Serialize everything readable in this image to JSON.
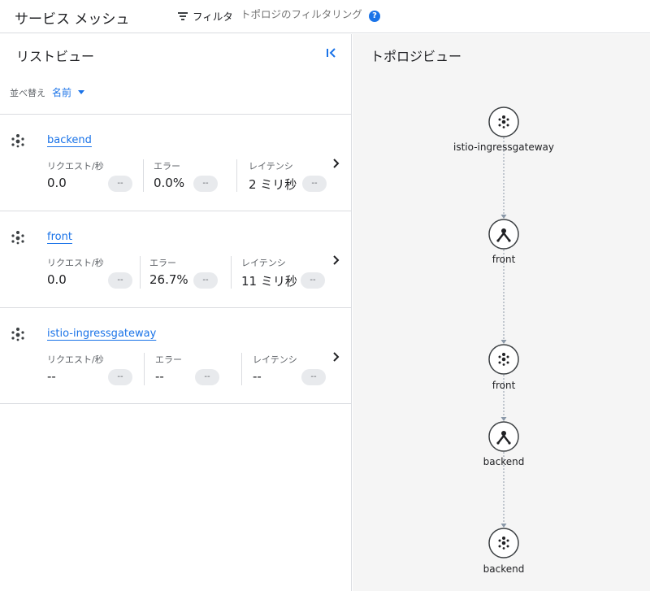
{
  "header": {
    "title": "サービス メッシュ",
    "filter_label": "フィルタ",
    "filter_placeholder": "トポロジのフィルタリング",
    "help_icon": "help-icon"
  },
  "list_view": {
    "title": "リストビュー",
    "sort_label": "並べ替え",
    "sort_value": "名前",
    "metric_labels": {
      "requests": "リクエスト/秒",
      "errors": "エラー",
      "latency": "レイテンシ"
    },
    "chip_text": "--",
    "services": [
      {
        "name": "backend",
        "requests": "0.0",
        "errors": "0.0%",
        "latency": "2 ミリ秒"
      },
      {
        "name": "front",
        "requests": "0.0",
        "errors": "26.7%",
        "latency": "11 ミリ秒"
      },
      {
        "name": "istio-ingressgateway",
        "requests": "--",
        "errors": "--",
        "latency": "--"
      }
    ]
  },
  "topology": {
    "title": "トポロジビュー",
    "nodes": [
      {
        "label": "istio-ingressgateway",
        "kind": "service-icon"
      },
      {
        "label": "front",
        "kind": "workload-icon"
      },
      {
        "label": "front",
        "kind": "service-icon"
      },
      {
        "label": "backend",
        "kind": "workload-icon"
      },
      {
        "label": "backend",
        "kind": "service-icon"
      }
    ]
  },
  "colors": {
    "link": "#1a73e8",
    "divider": "#dadce0",
    "topology_bg": "#f5f5f5",
    "edge": "#8a98a8"
  }
}
